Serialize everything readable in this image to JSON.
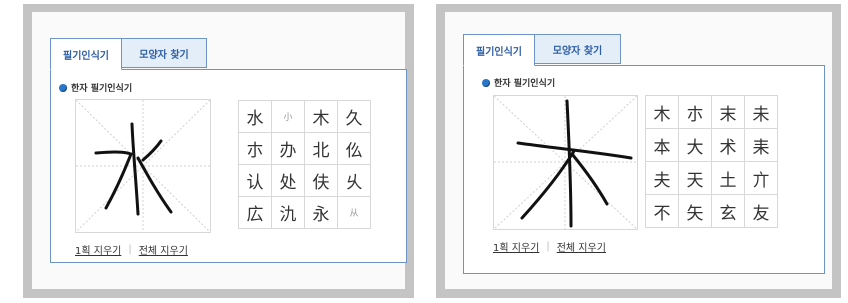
{
  "panels": [
    {
      "tabs": [
        {
          "label": "필기인식기"
        },
        {
          "label": "모양자 찾기"
        }
      ],
      "section_title": "한자 필기인식기",
      "candidates": [
        "水",
        "小",
        "木",
        "久",
        "朩",
        "办",
        "北",
        "仫",
        "认",
        "处",
        "伕",
        "乆",
        "広",
        "氿",
        "永",
        "从"
      ],
      "actions": {
        "clear_one": "1획 지우기",
        "clear_all": "전체 지우기"
      }
    },
    {
      "tabs": [
        {
          "label": "필기인식기"
        },
        {
          "label": "모양자 찾기"
        }
      ],
      "section_title": "한자 필기인식기",
      "candidates": [
        "木",
        "朩",
        "末",
        "未",
        "本",
        "大",
        "术",
        "耒",
        "夫",
        "天",
        "土",
        "亣",
        "不",
        "矢",
        "玄",
        "友"
      ],
      "actions": {
        "clear_one": "1획 지우기",
        "clear_all": "전체 지우기"
      }
    }
  ],
  "colors": {
    "accent": "#2f5fa6",
    "border": "#6e93c6",
    "frame": "#c4c4c4"
  }
}
